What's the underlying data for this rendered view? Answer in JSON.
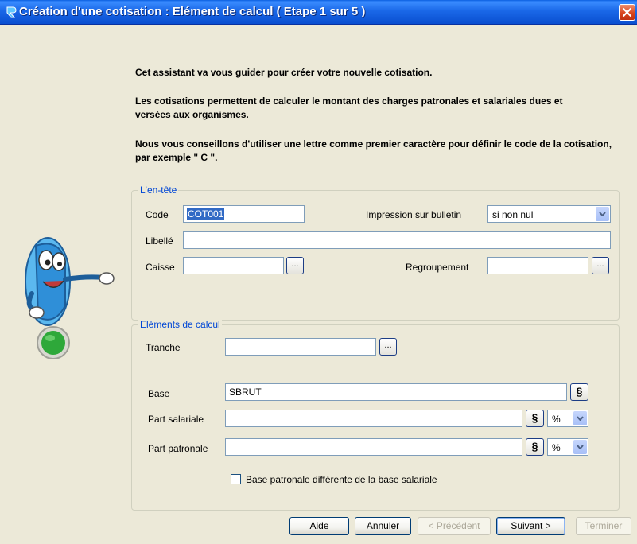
{
  "window": {
    "title": "Création d'une cotisation : Elément de calcul ( Etape 1 sur 5 )"
  },
  "intro": {
    "line1": "Cet assistant va vous guider pour créer votre nouvelle cotisation.",
    "line2": "Les cotisations permettent de calculer le montant des charges patronales et salariales dues et versées aux organismes.",
    "line3": "Nous vous conseillons d'utiliser une lettre comme premier caractère pour définir le code de la cotisation, par exemple \" C \"."
  },
  "entete": {
    "legend": "L'en-tête",
    "code_label": "Code",
    "code_value": "COT001",
    "impression_label": "Impression sur bulletin",
    "impression_value": "si non nul",
    "libelle_label": "Libellé",
    "libelle_value": "",
    "caisse_label": "Caisse",
    "caisse_value": "",
    "regroupement_label": "Regroupement",
    "regroupement_value": "",
    "browse_label": "..."
  },
  "calcul": {
    "legend": "Eléments de calcul",
    "tranche_label": "Tranche",
    "tranche_value": "",
    "base_label": "Base",
    "base_value": "SBRUT",
    "part_salariale_label": "Part salariale",
    "part_salariale_value": "",
    "part_salariale_unit": "%",
    "part_patronale_label": "Part patronale",
    "part_patronale_value": "",
    "part_patronale_unit": "%",
    "section_symbol": "§",
    "checkbox_label": "Base patronale différente de la base salariale",
    "checkbox_checked": false
  },
  "buttons": {
    "aide": "Aide",
    "annuler": "Annuler",
    "precedent": "< Précédent",
    "suivant": "Suivant >",
    "terminer": "Terminer"
  },
  "colors": {
    "titlebar": "#0a5fe0",
    "legend_text": "#0046d5",
    "dialog_bg": "#ece9d8",
    "mascot_blue": "#3aa8e8",
    "status_light": "#2ea83a"
  }
}
